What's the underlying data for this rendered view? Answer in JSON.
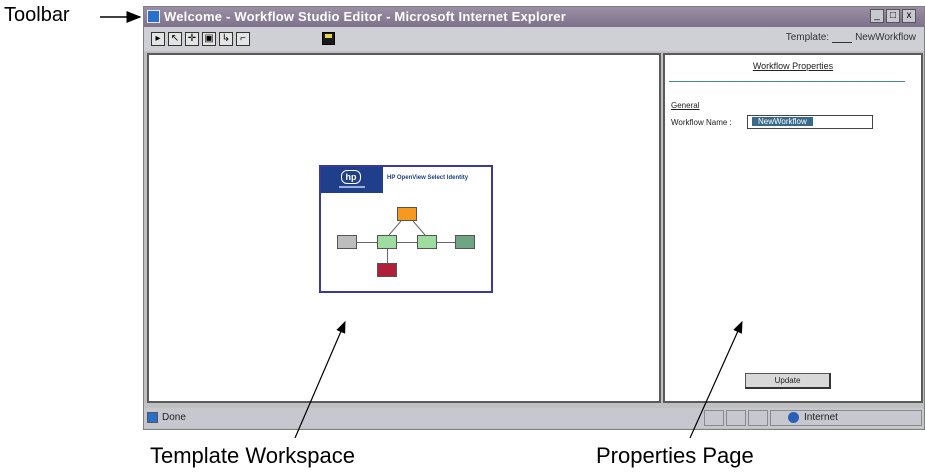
{
  "callouts": {
    "toolbar": "Toolbar",
    "workspace": "Template Workspace",
    "properties": "Properties Page"
  },
  "window": {
    "title": "Welcome - Workflow Studio Editor - Microsoft Internet Explorer",
    "min_glyph": "_",
    "max_glyph": "□",
    "close_glyph": "x"
  },
  "toolbar": {
    "template_label": "Template:",
    "template_value": "NewWorkflow"
  },
  "template_card": {
    "logo": "hp",
    "title": "HP OpenView Select Identity"
  },
  "properties": {
    "title": "Workflow Properties",
    "section": "General",
    "field_label": "Workflow Name :",
    "field_value": "NewWorkflow",
    "update_label": "Update"
  },
  "statusbar": {
    "status": "Done",
    "zone": "Internet"
  },
  "colors": {
    "titlebar": "#8a7f96",
    "node_orange": "#f59a1f",
    "node_green": "#9fdc9f",
    "node_gray": "#bdbdbd",
    "node_darkgreen": "#6fa584",
    "node_red": "#b0203a"
  }
}
